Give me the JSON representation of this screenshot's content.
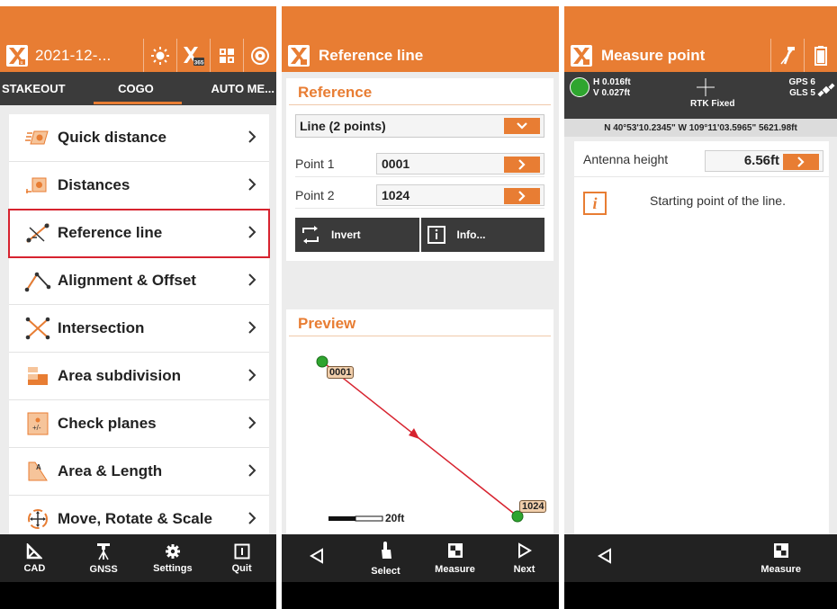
{
  "panel1": {
    "title": "2021-12-...",
    "tabs": [
      "STAKEOUT",
      "COGO",
      "AUTO ME..."
    ],
    "active_tab": "COGO",
    "menu": [
      {
        "label": "Quick distance",
        "icon": "quick-distance-icon"
      },
      {
        "label": "Distances",
        "icon": "distances-icon"
      },
      {
        "label": "Reference line",
        "icon": "reference-line-icon"
      },
      {
        "label": "Alignment & Offset",
        "icon": "alignment-offset-icon"
      },
      {
        "label": "Intersection",
        "icon": "intersection-icon"
      },
      {
        "label": "Area subdivision",
        "icon": "area-subdivision-icon"
      },
      {
        "label": "Check planes",
        "icon": "check-planes-icon"
      },
      {
        "label": "Area & Length",
        "icon": "area-length-icon"
      },
      {
        "label": "Move, Rotate & Scale",
        "icon": "move-rotate-scale-icon"
      }
    ],
    "bottom": [
      "CAD",
      "GNSS",
      "Settings",
      "Quit"
    ],
    "logo_badge": "365"
  },
  "panel2": {
    "title": "Reference line",
    "reference_heading": "Reference",
    "line_type": "Line (2 points)",
    "point1_label": "Point 1",
    "point1_value": "0001",
    "point2_label": "Point 2",
    "point2_value": "1024",
    "invert_label": "Invert",
    "info_label": "Info...",
    "preview_heading": "Preview",
    "scale_label": "20ft",
    "bottom": [
      "Select",
      "Measure",
      "Next"
    ]
  },
  "panel3": {
    "title": "Measure point",
    "h_precision": "H 0.016ft",
    "v_precision": "V 0.027ft",
    "fix_status": "RTK Fixed",
    "gps_count": "GPS 6",
    "gls_count": "GLS 5",
    "coordinates": "N 40°53'10.2345\" W 109°11'03.5965\" 5621.98ft",
    "antenna_label": "Antenna height",
    "antenna_value": "6.56ft",
    "info_text": "Starting point of the line.",
    "bottom": [
      "Measure"
    ]
  },
  "colors": {
    "accent": "#e87d33",
    "dark_bar": "#3b3b3b",
    "fixed_green": "#2fa52f",
    "selection": "#d7232f"
  }
}
